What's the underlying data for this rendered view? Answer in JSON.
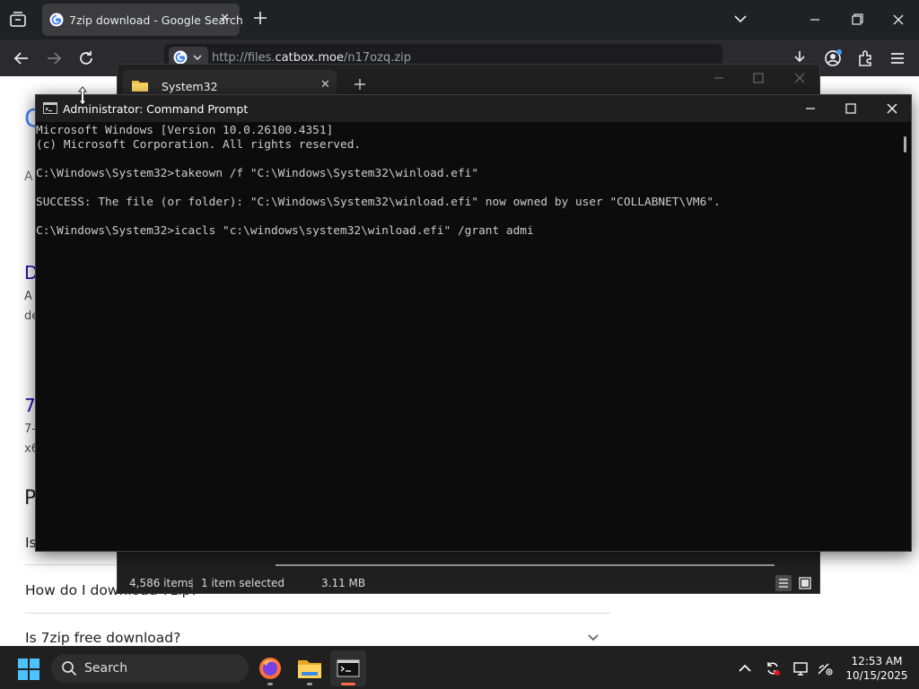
{
  "browser": {
    "tab": {
      "title": "7zip download - Google Search",
      "close": "✕"
    },
    "url": {
      "prefix": "http://files.",
      "domain": "catbox.moe",
      "path": "/n17ozq.zip"
    }
  },
  "google": {
    "logo_letter": "G",
    "tabs_letter": "A",
    "result1": {
      "title_start": "D",
      "snippet1": "A",
      "snippet2": "de"
    },
    "result2": {
      "title_start": "7",
      "snippet1": "7-",
      "snippet2": "x6"
    },
    "paa": {
      "heading_start": "P",
      "q1": "Is",
      "q2": "How do I download 7zip?",
      "q3": "Is 7zip free download?"
    }
  },
  "explorer": {
    "tab_title": "System32",
    "close": "✕",
    "status": {
      "items": "4,586 items",
      "selected": "1 item selected",
      "size": "3.11 MB",
      "sep": "|"
    }
  },
  "cmd": {
    "title": "Administrator: Command Prompt",
    "lines": [
      "Microsoft Windows [Version 10.0.26100.4351]",
      "(c) Microsoft Corporation. All rights reserved.",
      "",
      "C:\\Windows\\System32>takeown /f \"C:\\Windows\\System32\\winload.efi\"",
      "",
      "SUCCESS: The file (or folder): \"C:\\Windows\\System32\\winload.efi\" now owned by user \"COLLABNET\\VM6\".",
      "",
      "C:\\Windows\\System32>icacls \"c:\\windows\\system32\\winload.efi\" /grant admi"
    ]
  },
  "taskbar": {
    "search_label": "Search",
    "time": "12:53 AM",
    "date": "10/15/2025"
  },
  "colors": {
    "accent_blue": "#0078d4",
    "google_link": "#1a0dab",
    "cmd_text": "#cccccc",
    "taskbar_bg": "#202020"
  },
  "icons": [
    "tab-list-icon",
    "google-favicon",
    "new-tab-icon",
    "back-icon",
    "forward-icon",
    "reload-icon",
    "download-icon",
    "profile-icon",
    "extensions-icon",
    "menu-icon",
    "folder-icon",
    "cmd-icon",
    "windows-start-icon",
    "search-icon",
    "firefox-icon",
    "file-explorer-icon",
    "terminal-icon",
    "chevron-up-icon",
    "sync-icon",
    "display-icon",
    "network-icon"
  ]
}
